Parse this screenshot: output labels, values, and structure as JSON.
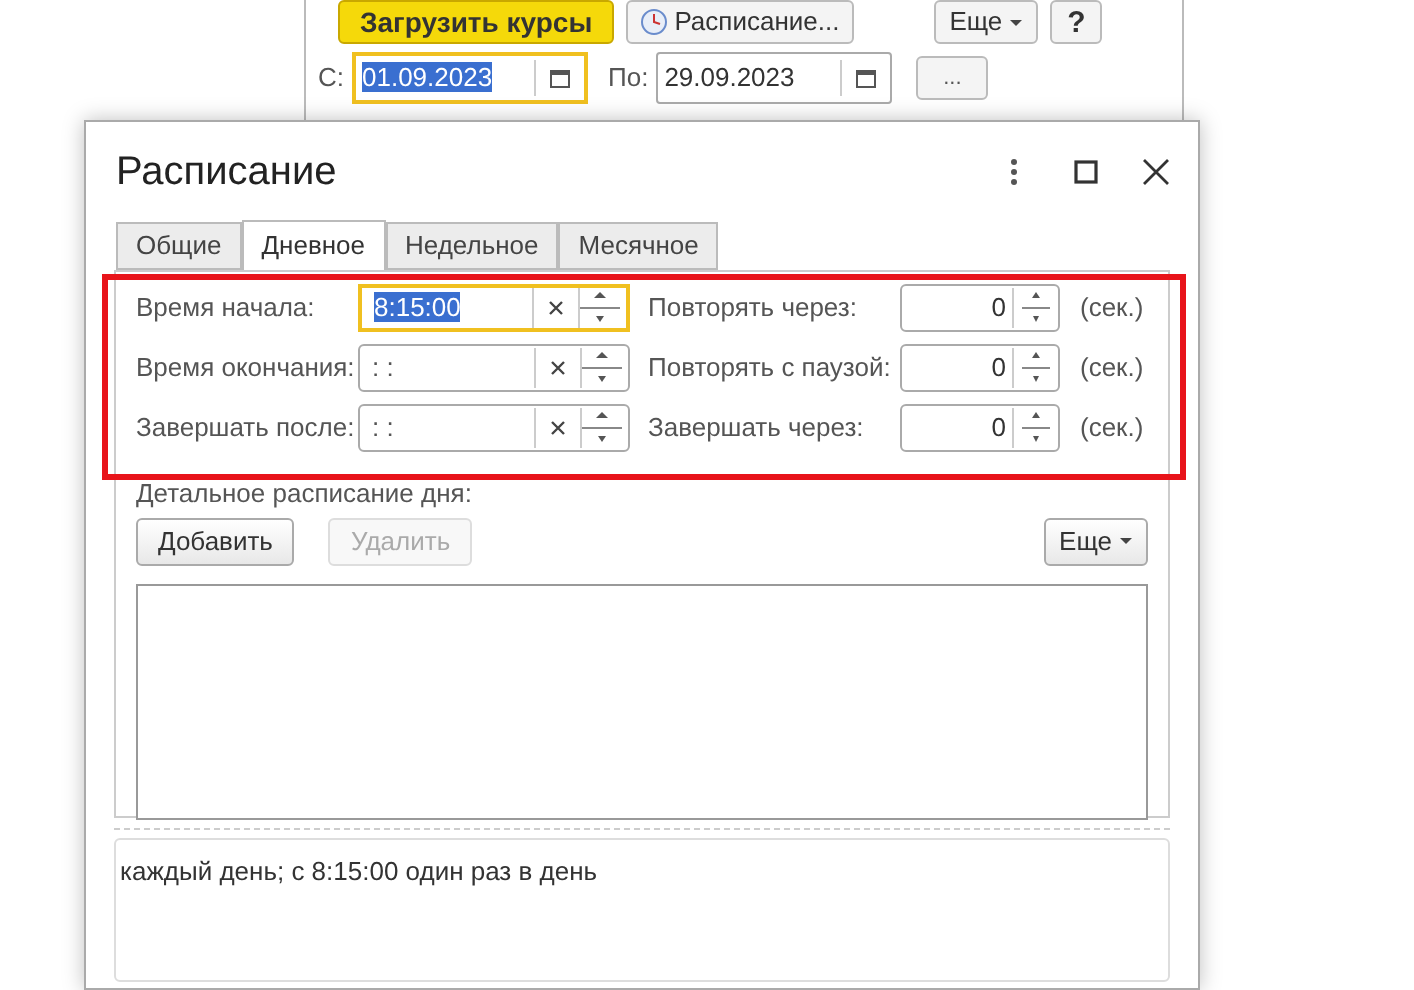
{
  "background_window": {
    "buttons": [
      {
        "kind": "primary",
        "label": "Загрузить курсы"
      },
      {
        "kind": "icon",
        "label": "Расписание..."
      },
      {
        "kind": "menu",
        "label": "Еще"
      },
      {
        "kind": "plain",
        "label": "?"
      }
    ],
    "period": {
      "from_label": "С:",
      "from": "01.09.2023",
      "from_focused": true,
      "to_label": "По:",
      "to": "29.09.2023",
      "more_button": "..."
    }
  },
  "dialog": {
    "title": "Расписание",
    "tabs": [
      {
        "label": "Общие",
        "selected": false
      },
      {
        "label": "Дневное",
        "selected": true
      },
      {
        "label": "Недельное",
        "selected": false
      },
      {
        "label": "Месячное",
        "selected": false
      }
    ],
    "highlighted": true,
    "time_fields": [
      {
        "label": "Время начала:",
        "value": "8:15:00",
        "focused": true
      },
      {
        "label": "Время окончания:",
        "value": ": :",
        "focused": false
      },
      {
        "label": "Завершать после:",
        "value": ": :",
        "focused": false
      }
    ],
    "second_fields": [
      {
        "label": "Повторять через:",
        "value": "0",
        "unit": "(сек.)"
      },
      {
        "label": "Повторять с паузой:",
        "value": "0",
        "unit": "(сек.)"
      },
      {
        "label": "Завершать через:",
        "value": "0",
        "unit": "(сек.)"
      }
    ],
    "detail_label": "Детальное расписание дня:",
    "buttons": [
      {
        "label": "Добавить",
        "disabled": false
      },
      {
        "label": "Удалить",
        "disabled": true
      }
    ],
    "more_button": "Еще",
    "summary": "каждый день; с 8:15:00 один раз в день"
  }
}
